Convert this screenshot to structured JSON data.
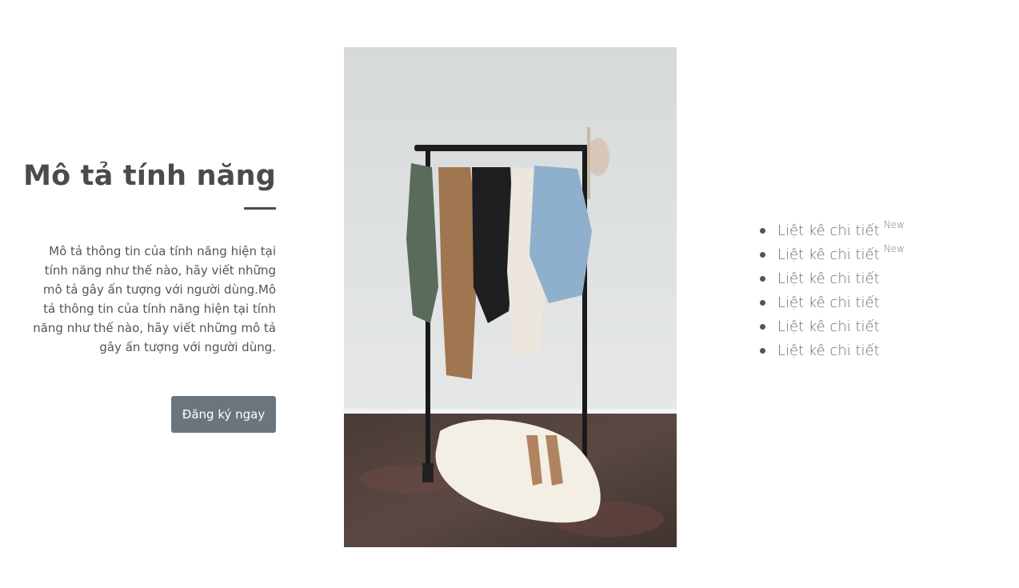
{
  "feature": {
    "title": "Mô tả tính năng",
    "description": "Mô tả thông tin của tính năng hiện tại tính năng như thế nào, hãy viết những mô tả gây ấn tượng với người dùng.Mô tả thông tin của tính năng hiện tại tính năng như thế nào, hãy viết những mô tả gây ấn tượng với người dùng.",
    "button_label": "Đăng ký ngay"
  },
  "colors": {
    "button_bg": "#6c757d",
    "heading": "#4b4b4b",
    "text": "#555555"
  },
  "details": {
    "items": [
      {
        "label": "Liệt kê chi tiết",
        "badge": "New"
      },
      {
        "label": "Liệt kê chi tiết",
        "badge": "New"
      },
      {
        "label": "Liệt kê chi tiết",
        "badge": ""
      },
      {
        "label": "Liệt kê chi tiết",
        "badge": ""
      },
      {
        "label": "Liệt kê chi tiết",
        "badge": ""
      },
      {
        "label": "Liệt kê chi tiết",
        "badge": ""
      }
    ]
  }
}
